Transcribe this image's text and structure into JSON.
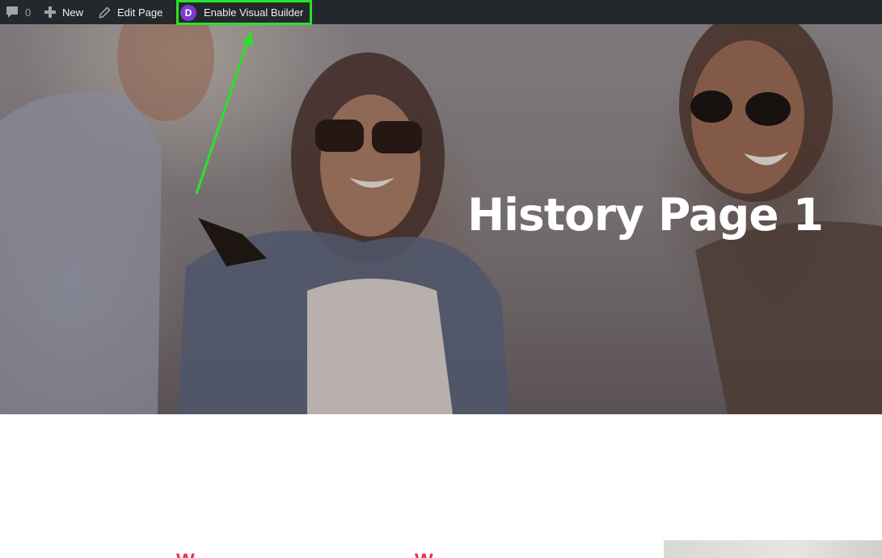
{
  "admin_bar": {
    "comments_count": "0",
    "new_label": "New",
    "edit_label": "Edit Page",
    "divi_logo_letter": "D",
    "visual_builder_label": "Enable Visual Builder"
  },
  "hero": {
    "title": "History Page 1"
  },
  "content": {
    "heading_1": "W",
    "heading_2": "W"
  },
  "colors": {
    "admin_bar_bg": "#23282d",
    "highlight_box": "#29e329",
    "divi_purple": "#7e3bd0",
    "accent_red": "#e0375b"
  }
}
